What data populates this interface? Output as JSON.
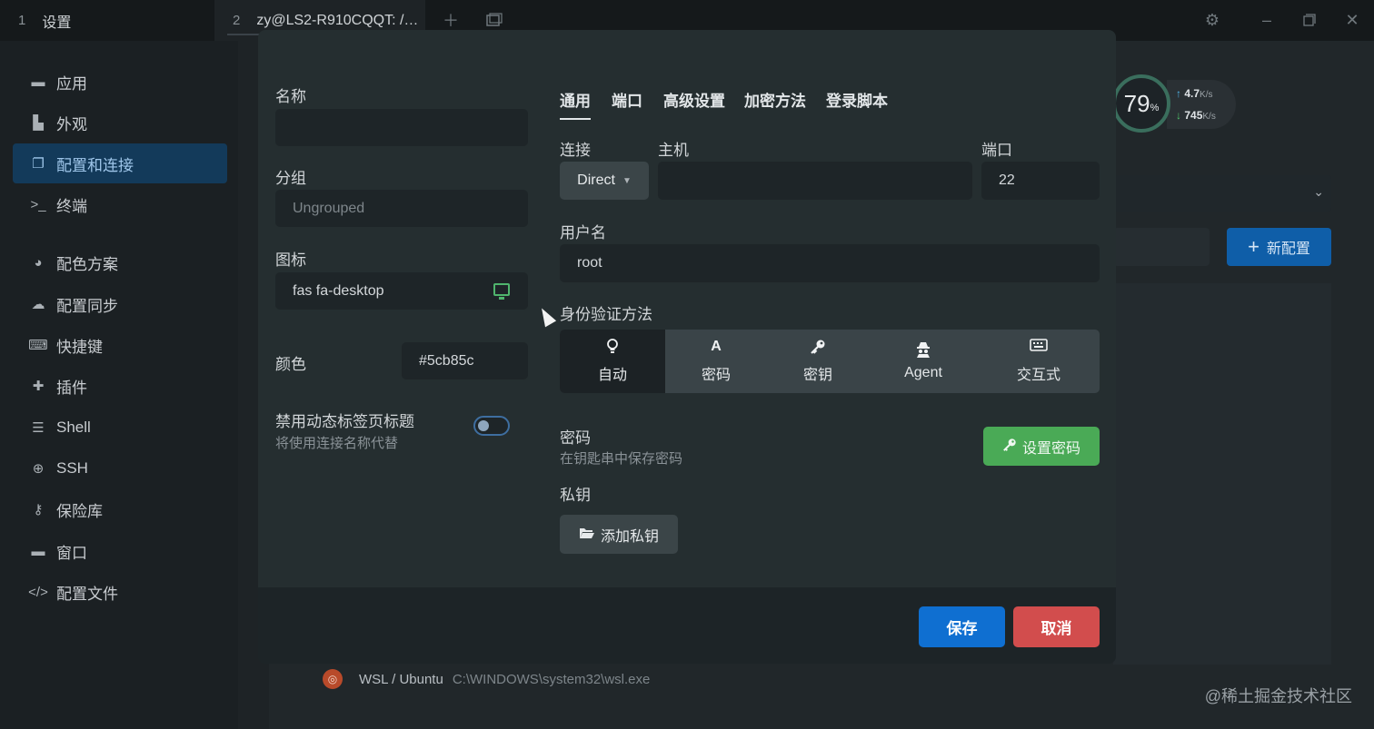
{
  "tabs": [
    {
      "num": "1",
      "label": "设置"
    },
    {
      "num": "2",
      "label": "zy@LS2-R910CQQT: /…"
    }
  ],
  "window_icons": {
    "add": "plus-icon",
    "split": "layout-icon",
    "settings": "gear-icon",
    "minimize": "minimize-icon",
    "maximize": "maximize-icon",
    "close": "close-icon"
  },
  "sidebar": {
    "items": [
      {
        "label": "应用",
        "icon": "window-icon"
      },
      {
        "label": "外观",
        "icon": "paint-icon"
      },
      {
        "label": "配置和连接",
        "icon": "window-restore-icon",
        "active": true
      },
      {
        "label": "终端",
        "icon": "terminal-icon"
      },
      {
        "label": "配色方案",
        "icon": "palette-icon"
      },
      {
        "label": "配置同步",
        "icon": "cloud-icon"
      },
      {
        "label": "快捷键",
        "icon": "keyboard-icon"
      },
      {
        "label": "插件",
        "icon": "puzzle-icon"
      },
      {
        "label": "Shell",
        "icon": "list-icon"
      },
      {
        "label": "SSH",
        "icon": "globe-icon"
      },
      {
        "label": "保险库",
        "icon": "key-icon"
      },
      {
        "label": "窗口",
        "icon": "window-icon"
      },
      {
        "label": "配置文件",
        "icon": "code-icon"
      }
    ]
  },
  "background": {
    "new_profile_label": "新配置",
    "profiles": [
      {
        "name": "WSL / Ubuntu",
        "path": "C:\\WINDOWS\\system32\\wsl.exe"
      }
    ]
  },
  "net_widget": {
    "percent": "79",
    "percent_unit": "%",
    "up": "4.7",
    "up_unit": "K/s",
    "down": "745",
    "down_unit": "K/s"
  },
  "watermark": "@稀土掘金技术社区",
  "modal": {
    "left": {
      "name_label": "名称",
      "name_value": "",
      "group_label": "分组",
      "group_placeholder": "Ungrouped",
      "icon_label": "图标",
      "icon_value": "fas fa-desktop",
      "color_label": "颜色",
      "color_value": "#5cb85c",
      "dynamic_title_label": "禁用动态标签页标题",
      "dynamic_title_sub": "将使用连接名称代替",
      "dynamic_title_on": false
    },
    "tabs": [
      "通用",
      "端口",
      "高级设置",
      "加密方法",
      "登录脚本"
    ],
    "active_tab": "通用",
    "connection_label": "连接",
    "connection_value": "Direct",
    "host_label": "主机",
    "host_value": "",
    "port_label": "端口",
    "port_value": "22",
    "username_label": "用户名",
    "username_value": "root",
    "auth_label": "身份验证方法",
    "auth_options": [
      {
        "label": "自动",
        "icon": "lightbulb-icon",
        "glyph": "💡",
        "active": true
      },
      {
        "label": "密码",
        "icon": "font-icon",
        "glyph": "A"
      },
      {
        "label": "密钥",
        "icon": "key-icon",
        "glyph": "⚿"
      },
      {
        "label": "Agent",
        "icon": "user-secret-icon",
        "glyph": "⛫"
      },
      {
        "label": "交互式",
        "icon": "keyboard-icon",
        "glyph": "⌨"
      }
    ],
    "password_label": "密码",
    "password_sub": "在钥匙串中保存密码",
    "set_password_label": "设置密码",
    "private_key_label": "私钥",
    "add_key_label": "添加私钥",
    "save_label": "保存",
    "cancel_label": "取消"
  },
  "colors": {
    "accent": "#0f6fd1",
    "danger": "#d24d4d",
    "success": "#4aaa56",
    "active_nav": "#133a5a"
  }
}
